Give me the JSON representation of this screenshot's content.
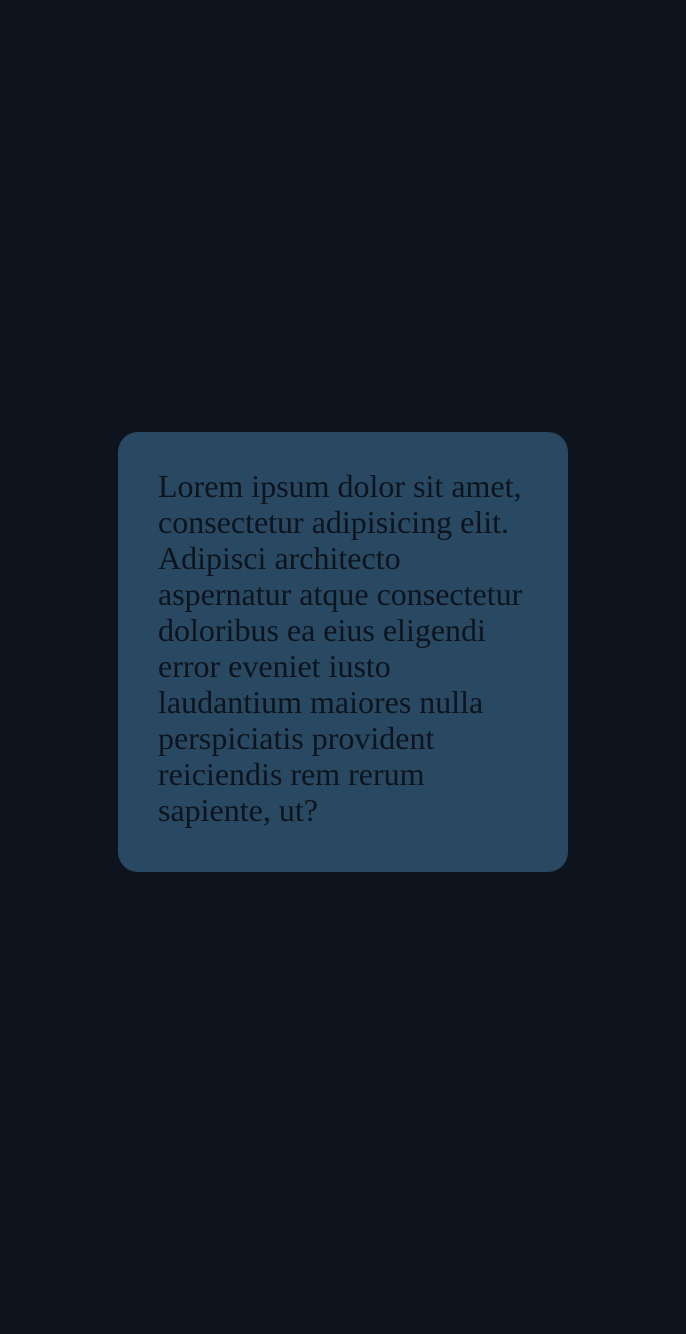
{
  "colors": {
    "background": "#0d141d",
    "card": "#294862",
    "text": "#0d141d"
  },
  "card": {
    "text": "Lorem ipsum dolor sit amet, consectetur adipisicing elit. Adipisci architecto aspernatur atque consectetur doloribus ea eius eligendi error eveniet iusto laudantium maiores nulla perspiciatis provident reiciendis rem rerum sapiente, ut?"
  }
}
